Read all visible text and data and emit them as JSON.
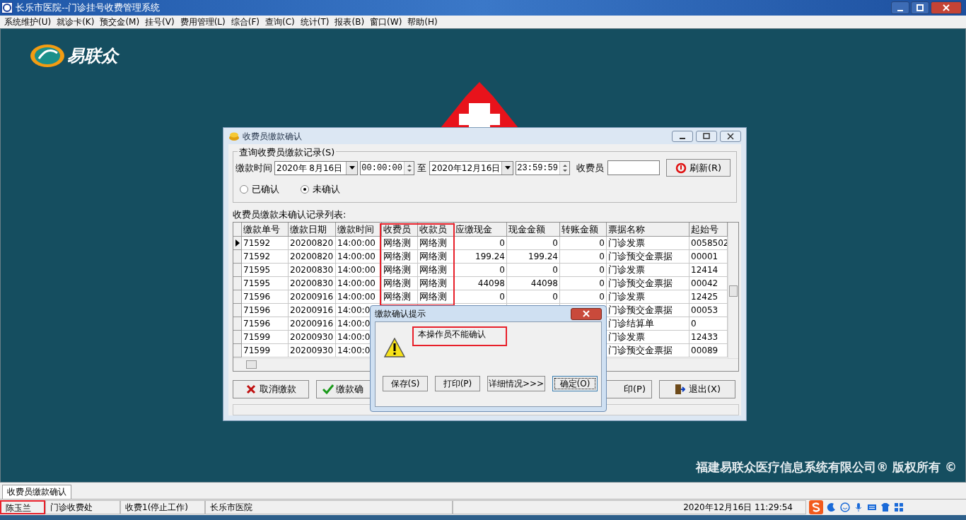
{
  "app_window": {
    "title": "长乐市医院--门诊挂号收费管理系统"
  },
  "menu": [
    "系统维护(U)",
    "就诊卡(K)",
    "预交金(M)",
    "挂号(V)",
    "费用管理(L)",
    "综合(F)",
    "查询(C)",
    "统计(T)",
    "报表(B)",
    "窗口(W)",
    "帮助(H)"
  ],
  "desktop": {
    "logo_text": "易联众",
    "copyright": "福建易联众医疗信息系统有限公司® 版权所有 ©"
  },
  "child_window": {
    "title": "收费员缴款确认",
    "query_group": {
      "legend": "查询收费员缴款记录(S)",
      "time_label": "缴款时间",
      "start_date": "2020年 8月16日",
      "start_time": "00:00:00",
      "to_label": "至",
      "end_date": "2020年12月16日",
      "end_time": "23:59:59",
      "cashier_label": "收费员",
      "refresh_button": "刷新(R)",
      "radios": [
        {
          "label": "已确认",
          "selected": false
        },
        {
          "label": "未确认",
          "selected": true
        }
      ]
    },
    "list_label": "收费员缴款未确认记录列表:",
    "table": {
      "columns": [
        "缴款单号",
        "缴款日期",
        "缴款时间",
        "收费员",
        "收款员",
        "应缴现金",
        "现金金额",
        "转账金额",
        "票据名称",
        "起始号"
      ],
      "rows": [
        {
          "current": true,
          "cells": [
            "71592",
            "20200820",
            "14:00:00",
            "网络测",
            "网络测",
            "0",
            "0",
            "0",
            "门诊发票",
            "0058502"
          ]
        },
        {
          "current": false,
          "cells": [
            "71592",
            "20200820",
            "14:00:00",
            "网络测",
            "网络测",
            "199.24",
            "199.24",
            "0",
            "门诊预交金票据",
            "00001"
          ]
        },
        {
          "current": false,
          "cells": [
            "71595",
            "20200830",
            "14:00:00",
            "网络测",
            "网络测",
            "0",
            "0",
            "0",
            "门诊发票",
            "12414"
          ]
        },
        {
          "current": false,
          "cells": [
            "71595",
            "20200830",
            "14:00:00",
            "网络测",
            "网络测",
            "44098",
            "44098",
            "0",
            "门诊预交金票据",
            "00042"
          ]
        },
        {
          "current": false,
          "cells": [
            "71596",
            "20200916",
            "14:00:00",
            "网络测",
            "网络测",
            "0",
            "0",
            "0",
            "门诊发票",
            "12425"
          ]
        },
        {
          "current": false,
          "cells": [
            "71596",
            "20200916",
            "14:00:0",
            null,
            null,
            null,
            null,
            null,
            "门诊预交金票据",
            "00053"
          ]
        },
        {
          "current": false,
          "cells": [
            "71596",
            "20200916",
            "14:00:0",
            null,
            null,
            null,
            null,
            null,
            "门诊结算单",
            "0"
          ]
        },
        {
          "current": false,
          "cells": [
            "71599",
            "20200930",
            "14:00:0",
            null,
            null,
            null,
            null,
            null,
            "门诊发票",
            "12433"
          ]
        },
        {
          "current": false,
          "cells": [
            "71599",
            "20200930",
            "14:00:0",
            null,
            null,
            null,
            null,
            null,
            "门诊预交金票据",
            "00089"
          ]
        }
      ]
    },
    "buttons": [
      "取消缴款",
      "缴款确",
      "印(P)",
      "退出(X)"
    ]
  },
  "dialog": {
    "title": "缴款确认提示",
    "message": "本操作员不能确认",
    "buttons": [
      {
        "label": "保存(S)",
        "default": false
      },
      {
        "label": "打印(P)",
        "default": false
      },
      {
        "label": "详细情况>>>",
        "default": false
      },
      {
        "label": "确定(O)",
        "default": true
      }
    ]
  },
  "window_tabs": [
    {
      "label": "收费员缴款确认",
      "selected": true
    }
  ],
  "status_bar": [
    "陈玉兰",
    "门诊收费处",
    "收费1(停止工作)",
    "长乐市医院",
    "2020年12月16日 11:29:54"
  ]
}
